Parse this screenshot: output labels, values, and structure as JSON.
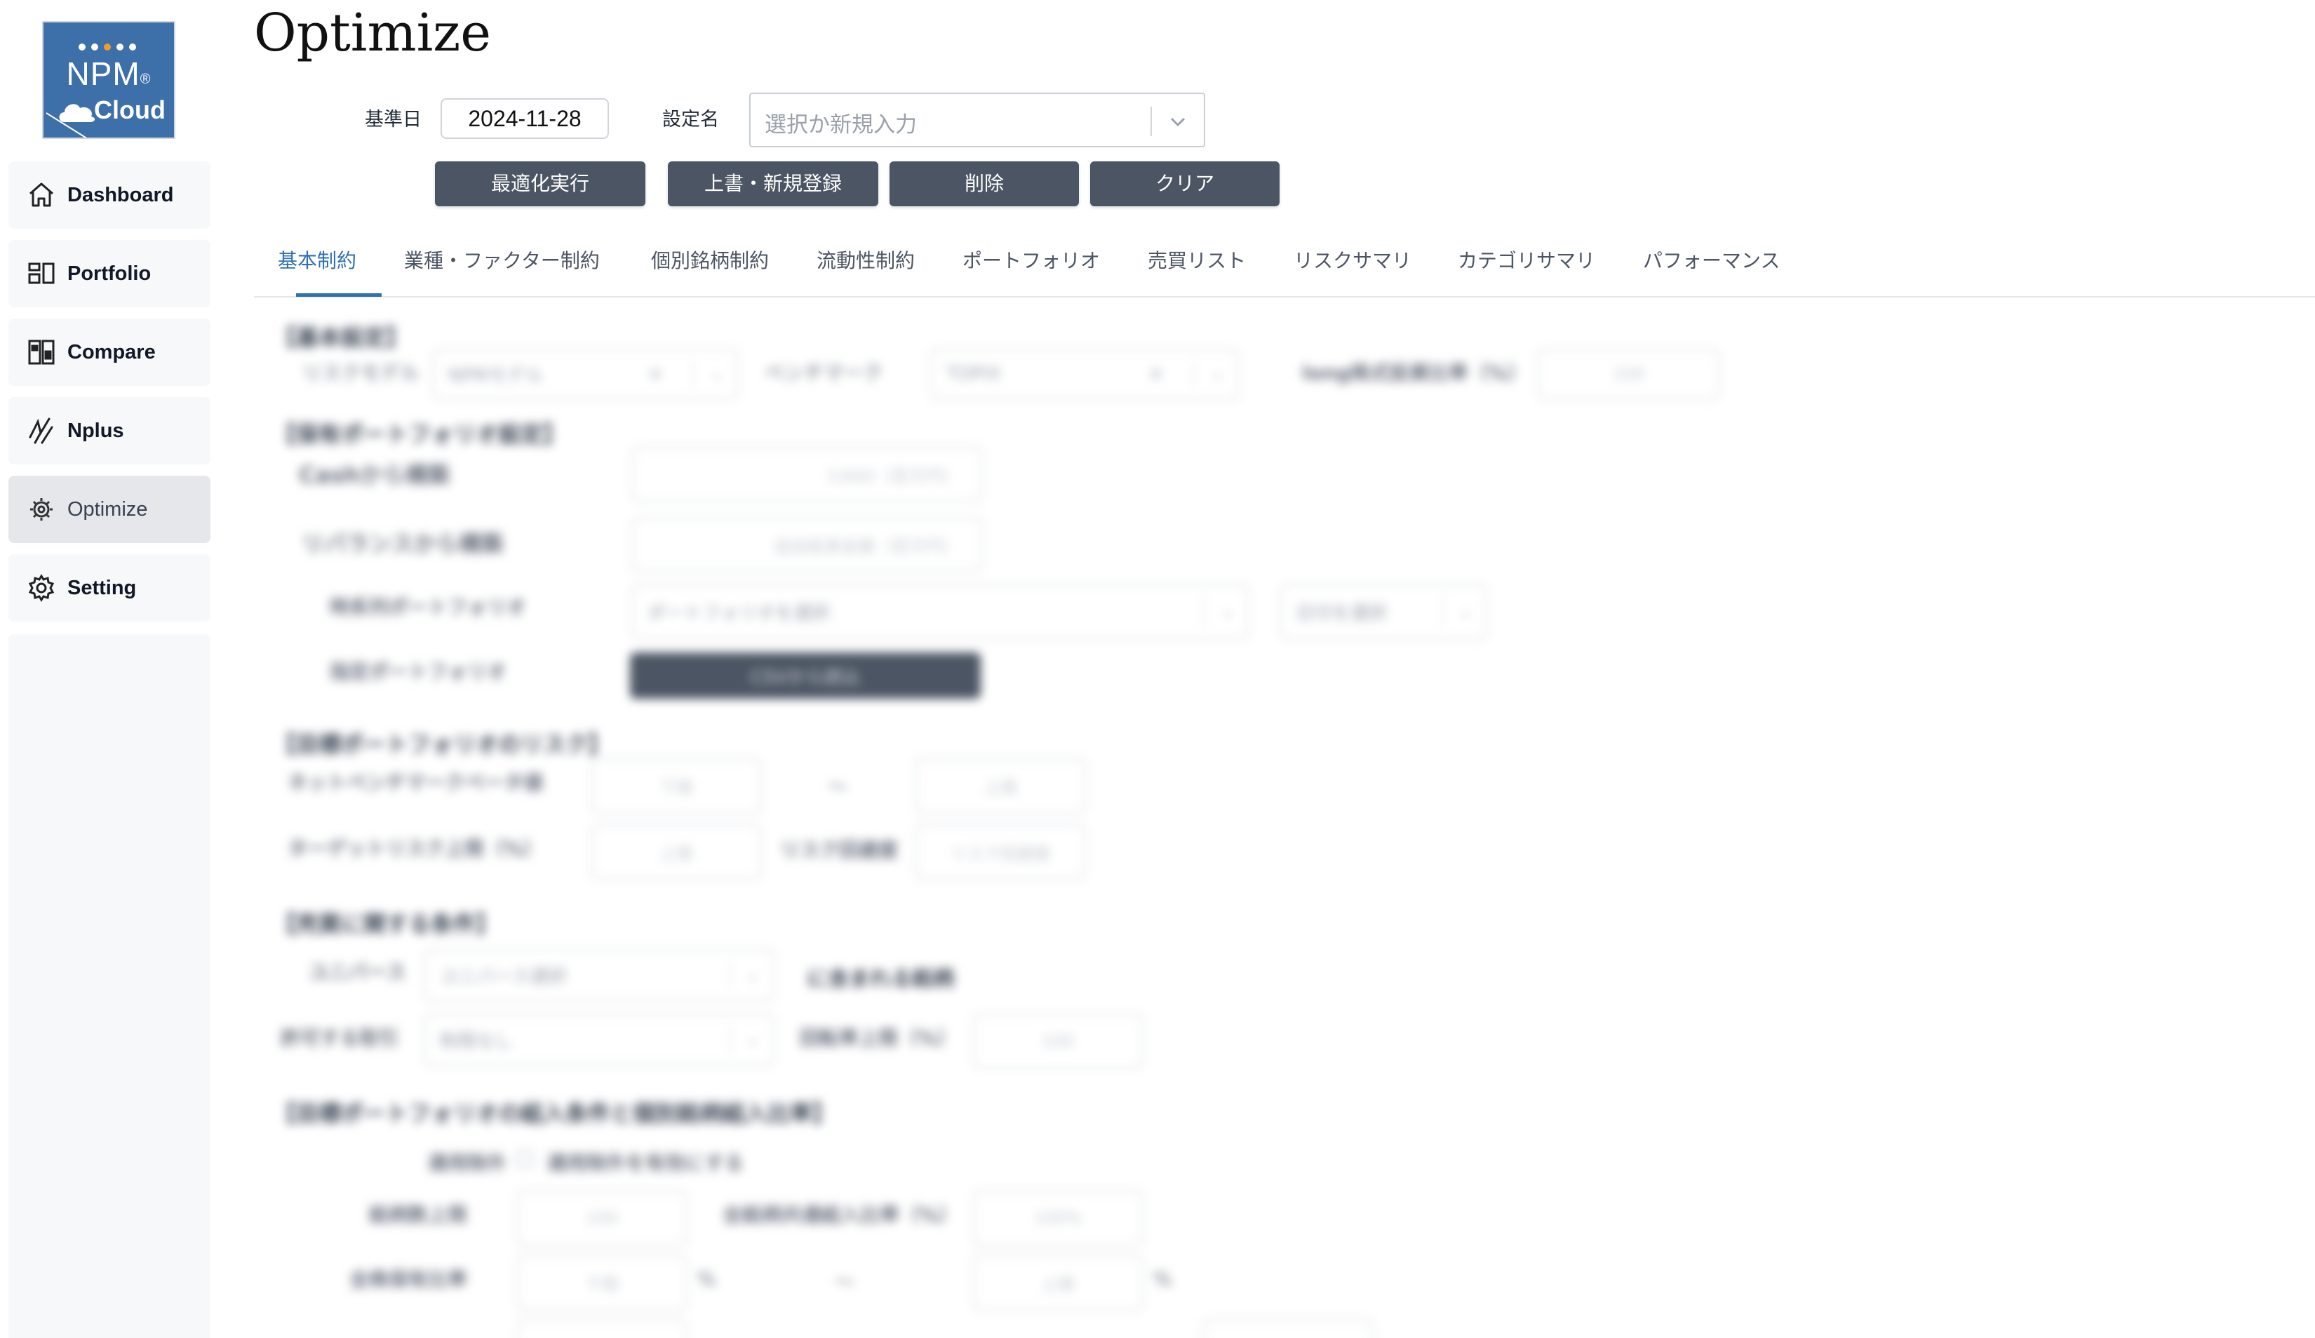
{
  "app": {
    "logo": {
      "top_text": "NPM",
      "reg_mark": "®",
      "bottom_text": "Cloud"
    }
  },
  "sidebar": {
    "items": [
      {
        "label": "Dashboard",
        "icon": "home-icon",
        "active": false
      },
      {
        "label": "Portfolio",
        "icon": "portfolio-icon",
        "active": false
      },
      {
        "label": "Compare",
        "icon": "compare-icon",
        "active": false
      },
      {
        "label": "Nplus",
        "icon": "nplus-icon",
        "active": false
      },
      {
        "label": "Optimize",
        "icon": "optimize-icon",
        "active": true
      },
      {
        "label": "Setting",
        "icon": "gear-icon",
        "active": false
      }
    ]
  },
  "header": {
    "title": "Optimize",
    "base_date_label": "基準日",
    "base_date_value": "2024-11-28",
    "setting_name_label": "設定名",
    "setting_name_placeholder": "選択か新規入力"
  },
  "actions": {
    "optimize": "最適化実行",
    "save": "上書・新規登録",
    "delete": "削除",
    "clear": "クリア"
  },
  "tabs": [
    {
      "label": "基本制約",
      "active": true
    },
    {
      "label": "業種・ファクター制約",
      "active": false
    },
    {
      "label": "個別銘柄制約",
      "active": false
    },
    {
      "label": "流動性制約",
      "active": false
    },
    {
      "label": "ポートフォリオ",
      "active": false
    },
    {
      "label": "売買リスト",
      "active": false
    },
    {
      "label": "リスクサマリ",
      "active": false
    },
    {
      "label": "カテゴリサマリ",
      "active": false
    },
    {
      "label": "パフォーマンス",
      "active": false
    }
  ],
  "colors": {
    "accent": "#2f6fb3",
    "button": "#4b5563",
    "logo_bg": "#3d6fa8",
    "sidebar_active": "#e5e7eb"
  },
  "form": {
    "basic": {
      "section": "【基本設定】",
      "risk_model_label": "リスクモデル",
      "risk_model_value": "NPMモデル",
      "benchmark_label": "ベンチマーク",
      "benchmark_value": "TOPIX",
      "long_ratio_label": "long株式投資比率（%）",
      "long_ratio_value": "100"
    },
    "holding": {
      "section": "【保有ポートフォリオ設定】",
      "from_cash_label": "Cashから構築",
      "cash_placeholder": "CASH（百万円）",
      "from_rebalance_label": "リバランスから構築",
      "additional_placeholder": "追加投資金額（百万円）",
      "existing_pf_label": "時系列ポートフォリオ",
      "existing_pf_placeholder": "ポートフォリオを選択",
      "date_placeholder": "日付を選択",
      "specified_pf_label": "指定ポートフォリオ",
      "csv_button": "CSVから読込"
    },
    "risk": {
      "section": "【目標ポートフォリオのリスク】",
      "beta_label": "ネットベンチマークベータ値",
      "lower_placeholder": "下限",
      "tilde": "〜",
      "upper_placeholder": "上限",
      "target_risk_label": "ターゲットリスク上限（%）",
      "target_upper_placeholder": "上限",
      "aversion_label": "リスク回避度",
      "aversion_placeholder": "リスク回避度"
    },
    "trade": {
      "section": "【売買に関する条件】",
      "universe_label": "ユニバース",
      "universe_placeholder": "ユニバース選択",
      "universe_suffix": "に含まれる銘柄",
      "allowed_label": "許可する取引",
      "allowed_value": "制限なし",
      "turnover_label": "回転率上限（%）",
      "turnover_value": "100"
    },
    "inclusion": {
      "section": "【目標ポートフォリオの組入条件と個別銘柄組入比率】",
      "exception_label": "適用除外",
      "exception_checkbox": "適用除外を有効にする",
      "count_label": "銘柄数上限",
      "count_value": "100",
      "total_ratio_label": "全銘柄共通組入比率（%）",
      "total_ratio_value": "100%",
      "holding_ratio_label": "全株保有比率",
      "lower_placeholder": "下限",
      "percent": "%",
      "tilde": "〜",
      "upper_placeholder": "上限"
    }
  }
}
